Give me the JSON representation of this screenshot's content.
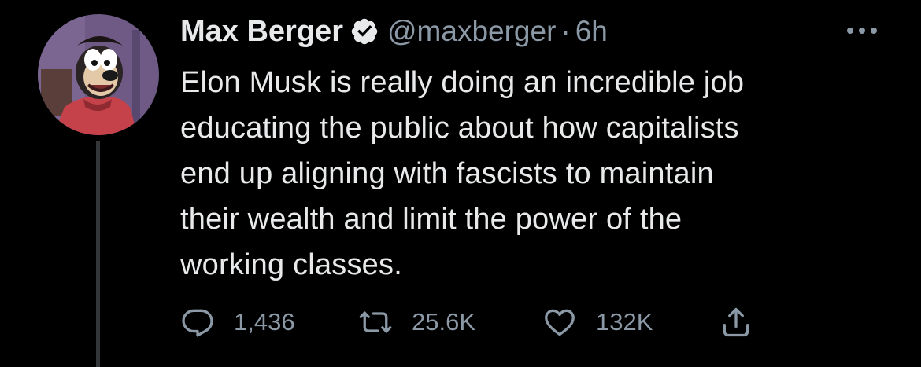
{
  "tweet": {
    "author": {
      "display_name": "Max Berger",
      "handle": "@maxberger",
      "verified": true,
      "avatar_icon": "cartoon-character-avatar"
    },
    "separator": "·",
    "time": "6h",
    "more_icon": "more-horizontal-icon",
    "text": "Elon Musk is really doing an incredible job\neducating the public about how capitalists\nend up aligning with fascists to maintain\ntheir wealth and limit the power of the\nworking classes.",
    "actions": {
      "reply": {
        "icon": "reply-icon",
        "count": "1,436"
      },
      "retweet": {
        "icon": "retweet-icon",
        "count": "25.6K"
      },
      "like": {
        "icon": "heart-icon",
        "count": "132K"
      },
      "share": {
        "icon": "share-icon"
      }
    }
  },
  "colors": {
    "background": "#000000",
    "text_primary": "#e7e9ea",
    "text_secondary": "#8b98a5",
    "thread_line": "#333639",
    "verified_badge": "#e7e9ea"
  }
}
